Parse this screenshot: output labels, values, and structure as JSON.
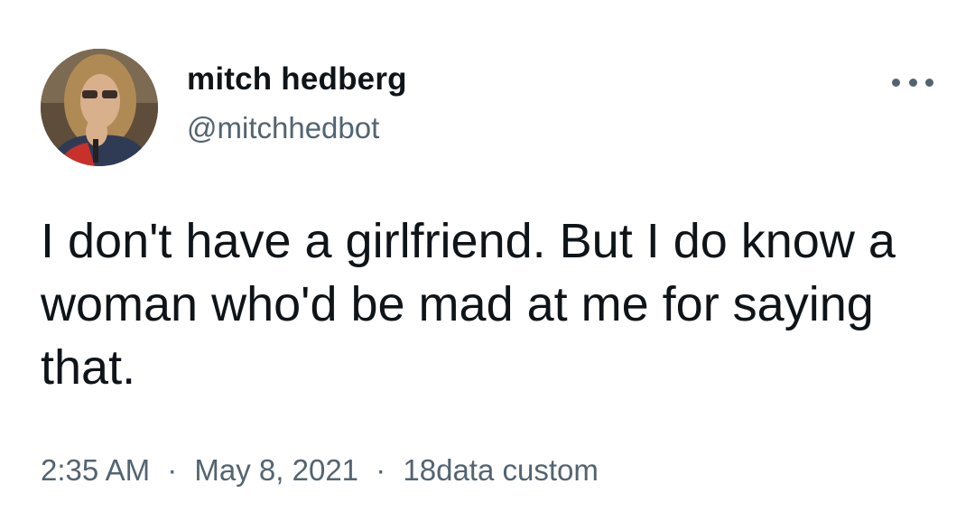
{
  "author": {
    "display_name": "mitch hedberg",
    "handle": "@mitchhedbot",
    "avatar_icon": "profile-photo"
  },
  "tweet": {
    "text": "I don't have a girlfriend. But I do know a woman who'd be mad at me for saying that.",
    "time": "2:35 AM",
    "date": "May 8, 2021",
    "source": "18data custom",
    "separator": "·"
  },
  "menu": {
    "icon": "more-horizontal-icon"
  },
  "colors": {
    "text_primary": "#0f1419",
    "text_secondary": "#536471",
    "background": "#ffffff"
  }
}
